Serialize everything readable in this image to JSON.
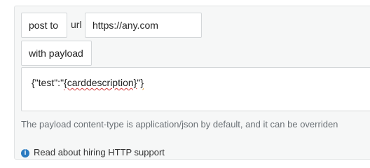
{
  "form": {
    "post_button_label": "post to",
    "url_label": "url",
    "url_value": "https://any.com",
    "payload_button_label": "with payload",
    "payload_prefix": "{\"test\":\"",
    "payload_token": "{carddescription}",
    "payload_mid": "\"",
    "payload_close": "}",
    "help_text": "The payload content-type is application/json by default, and it can be overriden",
    "info_text": "Read about hiring HTTP support"
  },
  "colors": {
    "panel_bg": "#f6f7f7",
    "muted_text": "#6b7176",
    "info_icon": "#2a7ac0"
  },
  "icons": {
    "info": "info-icon"
  }
}
